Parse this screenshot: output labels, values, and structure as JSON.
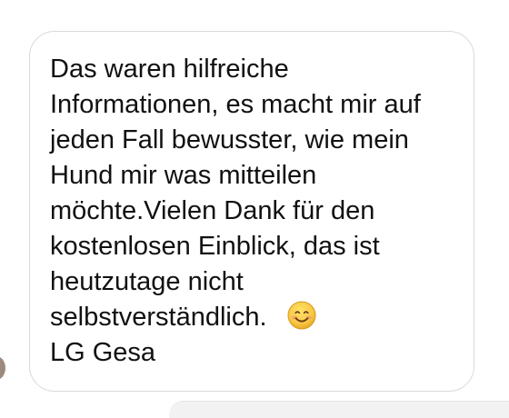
{
  "message": {
    "lines": [
      "Das waren hilfreiche",
      "Informationen, es macht mir auf",
      "jeden Fall bewusster, wie mein",
      "Hund mir was mitteilen",
      "möchte.Vielen Dank für den",
      "kostenlosen Einblick, das ist",
      "heutzutage nicht",
      "selbstverständlich.",
      "LG Gesa"
    ],
    "emoji_icon": "smiling-face-icon"
  },
  "colors": {
    "text": "#111111",
    "bubble_border": "#d9d9d9",
    "emoji": "#f6c84a"
  }
}
